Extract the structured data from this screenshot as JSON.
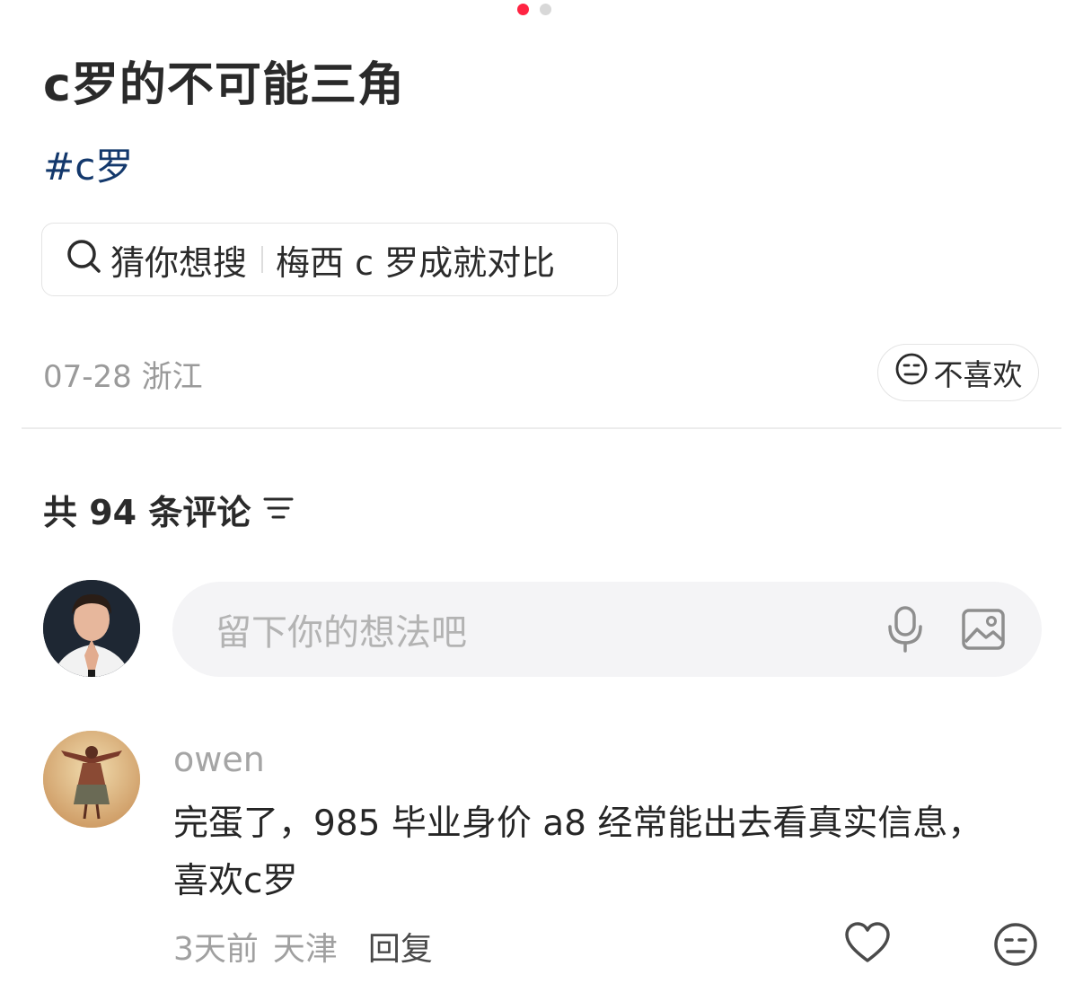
{
  "pager": {
    "active_color": "#ff2442",
    "inactive_color": "#d8d8d8"
  },
  "post": {
    "title": "c罗的不可能三角",
    "hashtag": "#c罗",
    "search_suggestion": {
      "label": "猜你想搜",
      "query": "梅西 c 罗成就对比",
      "icon": "search-icon"
    },
    "date": "07-28",
    "location": "浙江",
    "dislike_label": "不喜欢"
  },
  "comments": {
    "count_label": "共 94 条评论",
    "input_placeholder": "留下你的想法吧",
    "input_icons": [
      "microphone-icon",
      "image-icon"
    ],
    "items": [
      {
        "username": "owen",
        "text": "完蛋了，985 毕业身价 a8 经常能出去看真实信息，喜欢c罗",
        "time": "3天前",
        "location": "天津",
        "reply_label": "回复"
      }
    ]
  },
  "colors": {
    "hashtag": "#13386c",
    "text_primary": "#2a2a2a",
    "text_secondary": "#9a9a9a",
    "input_bg": "#f4f4f6"
  }
}
